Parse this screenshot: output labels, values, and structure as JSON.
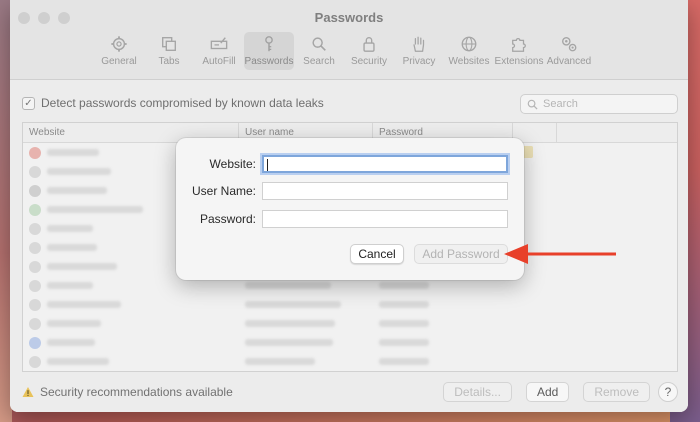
{
  "window": {
    "title": "Passwords"
  },
  "tabs": [
    {
      "label": "General",
      "icon": "gear-icon"
    },
    {
      "label": "Tabs",
      "icon": "tabs-icon"
    },
    {
      "label": "AutoFill",
      "icon": "autofill-icon"
    },
    {
      "label": "Passwords",
      "icon": "key-icon",
      "active": true
    },
    {
      "label": "Search",
      "icon": "search-icon"
    },
    {
      "label": "Security",
      "icon": "lock-icon"
    },
    {
      "label": "Privacy",
      "icon": "hand-icon"
    },
    {
      "label": "Websites",
      "icon": "globe-icon"
    },
    {
      "label": "Extensions",
      "icon": "puzzle-icon"
    },
    {
      "label": "Advanced",
      "icon": "gears-icon"
    }
  ],
  "detect": {
    "label": "Detect passwords compromised by known data leaks",
    "checked": true
  },
  "search": {
    "placeholder": "Search"
  },
  "table": {
    "columns": [
      "Website",
      "User name",
      "Password"
    ]
  },
  "footer": {
    "warning": "Security recommendations available",
    "details_label": "Details...",
    "add_label": "Add",
    "remove_label": "Remove",
    "help_label": "?"
  },
  "dialog": {
    "website_label": "Website:",
    "username_label": "User Name:",
    "password_label": "Password:",
    "cancel_label": "Cancel",
    "add_password_label": "Add Password"
  },
  "colors": {
    "arrow": "#e8402a",
    "focus_ring": "#7ea6db"
  }
}
